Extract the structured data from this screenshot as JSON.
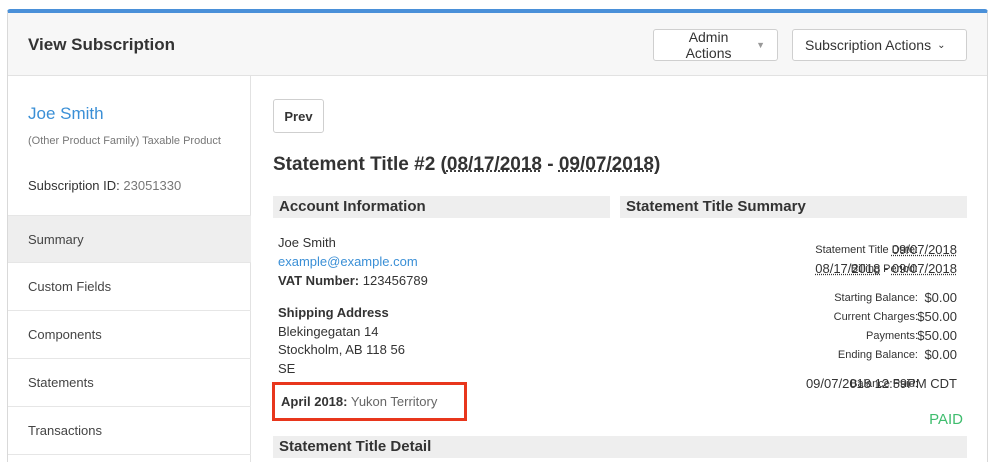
{
  "header": {
    "title": "View Subscription",
    "admin_actions": "Admin Actions",
    "subscription_actions": "Subscription Actions"
  },
  "sidebar": {
    "customer_name": "Joe Smith",
    "product": "(Other Product Family) Taxable Product",
    "subscription_id_label": "Subscription ID:",
    "subscription_id": "23051330",
    "nav": [
      {
        "label": "Summary",
        "active": true
      },
      {
        "label": "Custom Fields",
        "active": false
      },
      {
        "label": "Components",
        "active": false
      },
      {
        "label": "Statements",
        "active": false
      },
      {
        "label": "Transactions",
        "active": false
      }
    ]
  },
  "main": {
    "prev_label": "Prev",
    "statement_title": "Statement Title #2",
    "period_start": "08/17/2018",
    "period_sep": "-",
    "period_end": "09/07/2018",
    "account_info": {
      "heading": "Account Information",
      "name": "Joe Smith",
      "email": "example@example.com",
      "vat_label": "VAT Number:",
      "vat_value": "123456789",
      "shipping_label": "Shipping Address",
      "street": "Blekingegatan 14",
      "city_line": "Stockholm, AB 118 56",
      "country": "SE",
      "tax_label": "April 2018:",
      "tax_value": "Yukon Territory"
    },
    "summary": {
      "heading": "Statement Title Summary",
      "date_label": "Statement Title Date:",
      "date_value": "09/07/2018",
      "billing_label": "Billing Period:",
      "billing_start": "08/17/2018",
      "billing_sep": "-",
      "billing_end": "09/07/2018",
      "starting_label": "Starting Balance:",
      "starting_value": "$0.00",
      "charges_label": "Current Charges:",
      "charges_value": "$50.00",
      "payments_label": "Payments:",
      "payments_value": "$50.00",
      "ending_label": "Ending Balance:",
      "ending_value": "$0.00",
      "paid_label": "Balance Paid:",
      "paid_value": "09/07/2018 12:59PM CDT",
      "status": "PAID"
    },
    "detail_heading": "Statement Title Detail"
  },
  "colors": {
    "accent": "#4a90d9",
    "link": "#3a8fd6",
    "paid": "#3fbd6e",
    "highlight_border": "#e8361c"
  }
}
